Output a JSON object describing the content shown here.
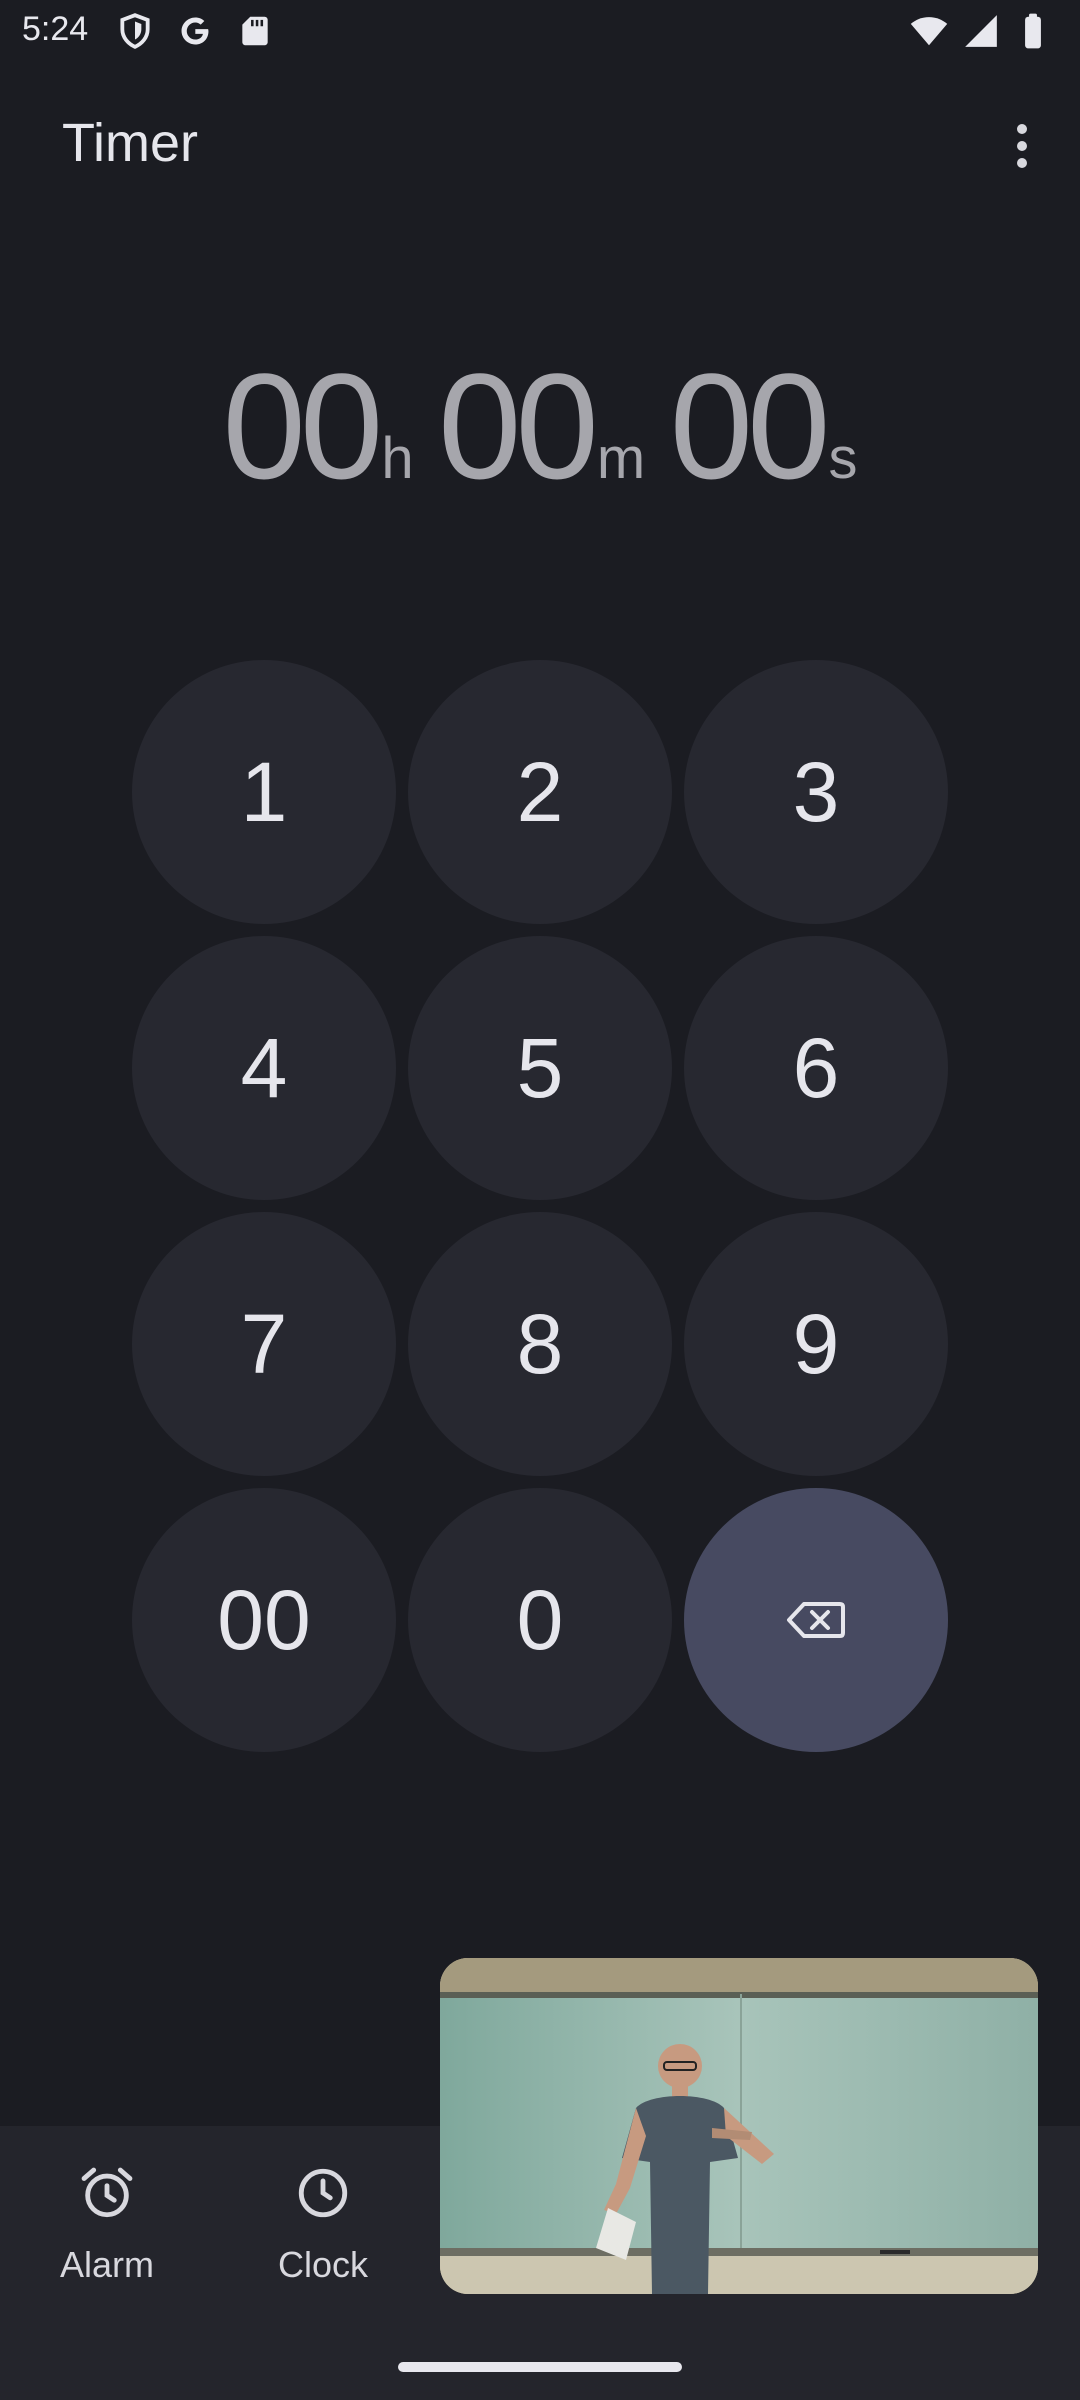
{
  "status_bar": {
    "time": "5:24",
    "left_icons": [
      "shield-icon",
      "google-icon",
      "sd-card-icon"
    ],
    "right_icons": [
      "wifi-icon",
      "signal-icon",
      "battery-icon"
    ]
  },
  "app_bar": {
    "title": "Timer",
    "menu_icon": "more-vert-icon"
  },
  "timer_readout": {
    "hours": "00",
    "hours_unit": "h",
    "minutes": "00",
    "minutes_unit": "m",
    "seconds": "00",
    "seconds_unit": "s"
  },
  "keypad": {
    "keys": [
      "1",
      "2",
      "3",
      "4",
      "5",
      "6",
      "7",
      "8",
      "9",
      "00",
      "0"
    ],
    "backspace_icon": "backspace-icon"
  },
  "bottom_nav": {
    "items": [
      {
        "label": "Alarm",
        "icon": "alarm-icon"
      },
      {
        "label": "Clock",
        "icon": "clock-icon"
      }
    ]
  },
  "pip": {
    "content": "video-player"
  },
  "colors": {
    "background": "#1b1c22",
    "key": "#272830",
    "backspace_key": "#474a61",
    "nav_background": "#24252c",
    "readout_text": "#a6a6ac"
  }
}
